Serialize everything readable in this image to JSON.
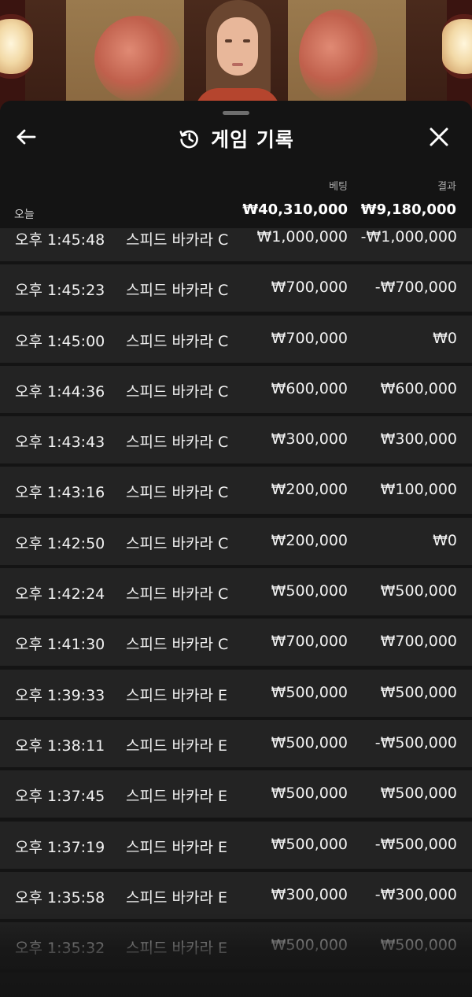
{
  "header": {
    "title": "게임 기록",
    "back_icon": "arrow-left-icon",
    "history_icon": "history-icon",
    "close_icon": "close-icon"
  },
  "columns": {
    "bet": "베팅",
    "result": "결과"
  },
  "summary": {
    "date": "오늘",
    "total_bet": "₩40,310,000",
    "total_result": "₩9,180,000"
  },
  "rows": [
    {
      "time": "오후 1:45:48",
      "game": "스피드 바카라 C",
      "bet": "₩1,000,000",
      "result": "-₩1,000,000"
    },
    {
      "time": "오후 1:45:23",
      "game": "스피드 바카라 C",
      "bet": "₩700,000",
      "result": "-₩700,000"
    },
    {
      "time": "오후 1:45:00",
      "game": "스피드 바카라 C",
      "bet": "₩700,000",
      "result": "₩0"
    },
    {
      "time": "오후 1:44:36",
      "game": "스피드 바카라 C",
      "bet": "₩600,000",
      "result": "₩600,000"
    },
    {
      "time": "오후 1:43:43",
      "game": "스피드 바카라 C",
      "bet": "₩300,000",
      "result": "₩300,000"
    },
    {
      "time": "오후 1:43:16",
      "game": "스피드 바카라 C",
      "bet": "₩200,000",
      "result": "₩100,000"
    },
    {
      "time": "오후 1:42:50",
      "game": "스피드 바카라 C",
      "bet": "₩200,000",
      "result": "₩0"
    },
    {
      "time": "오후 1:42:24",
      "game": "스피드 바카라 C",
      "bet": "₩500,000",
      "result": "₩500,000"
    },
    {
      "time": "오후 1:41:30",
      "game": "스피드 바카라 C",
      "bet": "₩700,000",
      "result": "₩700,000"
    },
    {
      "time": "오후 1:39:33",
      "game": "스피드 바카라 E",
      "bet": "₩500,000",
      "result": "₩500,000"
    },
    {
      "time": "오후 1:38:11",
      "game": "스피드 바카라 E",
      "bet": "₩500,000",
      "result": "-₩500,000"
    },
    {
      "time": "오후 1:37:45",
      "game": "스피드 바카라 E",
      "bet": "₩500,000",
      "result": "₩500,000"
    },
    {
      "time": "오후 1:37:19",
      "game": "스피드 바카라 E",
      "bet": "₩500,000",
      "result": "-₩500,000"
    },
    {
      "time": "오후 1:35:58",
      "game": "스피드 바카라 E",
      "bet": "₩300,000",
      "result": "-₩300,000"
    },
    {
      "time": "오후 1:35:32",
      "game": "스피드 바카라 E",
      "bet": "₩500,000",
      "result": "₩500,000"
    }
  ]
}
